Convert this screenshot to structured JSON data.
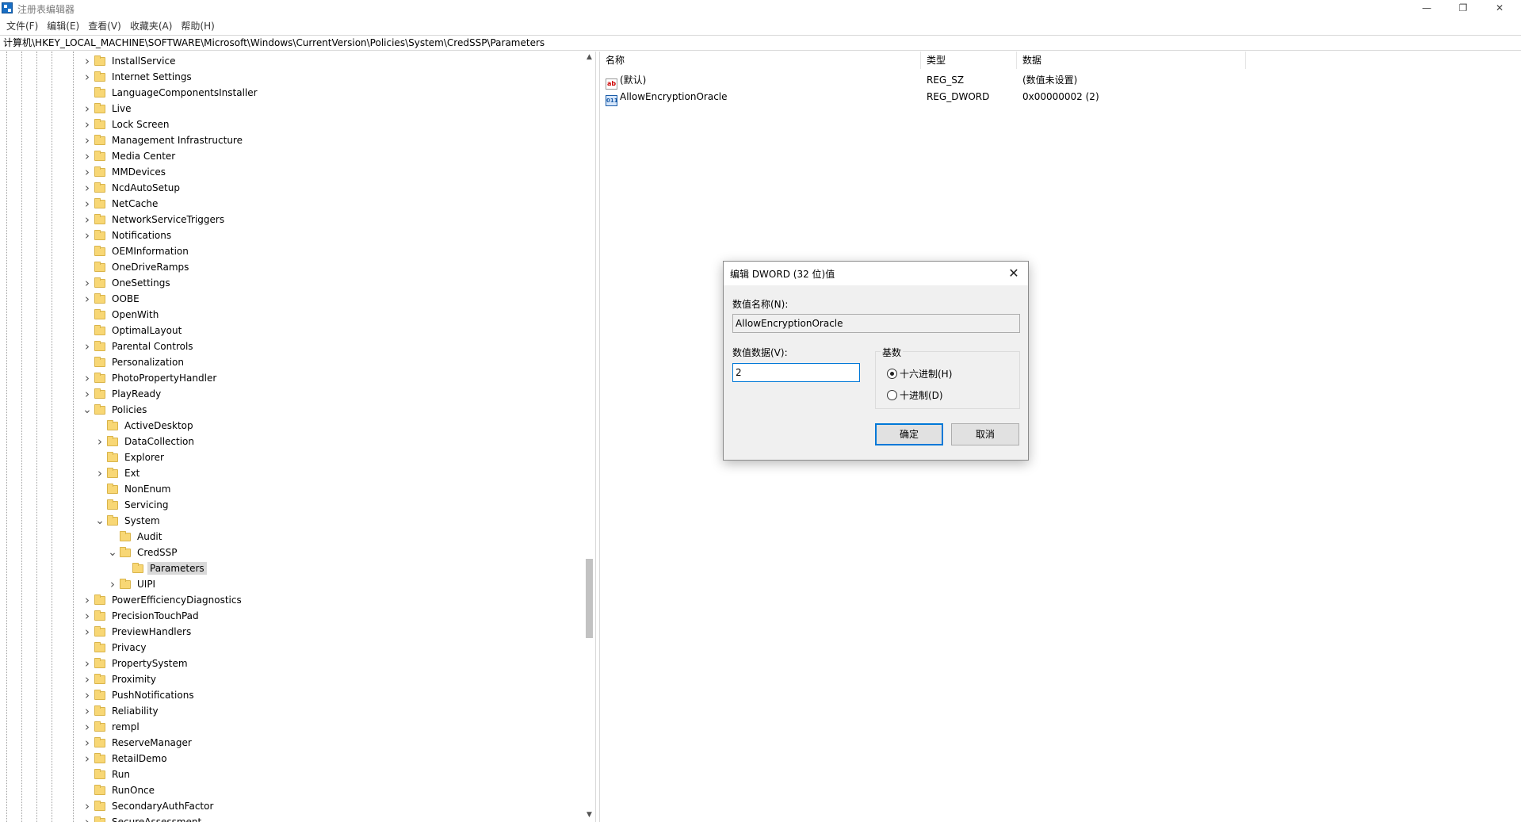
{
  "window": {
    "title": "注册表编辑器",
    "minimize_glyph": "—",
    "restore_glyph": "❐",
    "close_glyph": "✕"
  },
  "menu": [
    "文件(F)",
    "编辑(E)",
    "查看(V)",
    "收藏夹(A)",
    "帮助(H)"
  ],
  "address": "计算机\\HKEY_LOCAL_MACHINE\\SOFTWARE\\Microsoft\\Windows\\CurrentVersion\\Policies\\System\\CredSSP\\Parameters",
  "tree": [
    {
      "label": "InstallService",
      "level": 0,
      "expander": "collapsed"
    },
    {
      "label": "Internet Settings",
      "level": 0,
      "expander": "collapsed"
    },
    {
      "label": "LanguageComponentsInstaller",
      "level": 0,
      "expander": "none"
    },
    {
      "label": "Live",
      "level": 0,
      "expander": "collapsed"
    },
    {
      "label": "Lock Screen",
      "level": 0,
      "expander": "collapsed"
    },
    {
      "label": "Management Infrastructure",
      "level": 0,
      "expander": "collapsed"
    },
    {
      "label": "Media Center",
      "level": 0,
      "expander": "collapsed"
    },
    {
      "label": "MMDevices",
      "level": 0,
      "expander": "collapsed"
    },
    {
      "label": "NcdAutoSetup",
      "level": 0,
      "expander": "collapsed"
    },
    {
      "label": "NetCache",
      "level": 0,
      "expander": "collapsed"
    },
    {
      "label": "NetworkServiceTriggers",
      "level": 0,
      "expander": "collapsed"
    },
    {
      "label": "Notifications",
      "level": 0,
      "expander": "collapsed"
    },
    {
      "label": "OEMInformation",
      "level": 0,
      "expander": "none"
    },
    {
      "label": "OneDriveRamps",
      "level": 0,
      "expander": "none"
    },
    {
      "label": "OneSettings",
      "level": 0,
      "expander": "collapsed"
    },
    {
      "label": "OOBE",
      "level": 0,
      "expander": "collapsed"
    },
    {
      "label": "OpenWith",
      "level": 0,
      "expander": "none"
    },
    {
      "label": "OptimalLayout",
      "level": 0,
      "expander": "none"
    },
    {
      "label": "Parental Controls",
      "level": 0,
      "expander": "collapsed"
    },
    {
      "label": "Personalization",
      "level": 0,
      "expander": "none"
    },
    {
      "label": "PhotoPropertyHandler",
      "level": 0,
      "expander": "collapsed"
    },
    {
      "label": "PlayReady",
      "level": 0,
      "expander": "collapsed"
    },
    {
      "label": "Policies",
      "level": 0,
      "expander": "expanded"
    },
    {
      "label": "ActiveDesktop",
      "level": 1,
      "expander": "none"
    },
    {
      "label": "DataCollection",
      "level": 1,
      "expander": "collapsed"
    },
    {
      "label": "Explorer",
      "level": 1,
      "expander": "none"
    },
    {
      "label": "Ext",
      "level": 1,
      "expander": "collapsed"
    },
    {
      "label": "NonEnum",
      "level": 1,
      "expander": "none"
    },
    {
      "label": "Servicing",
      "level": 1,
      "expander": "none"
    },
    {
      "label": "System",
      "level": 1,
      "expander": "expanded"
    },
    {
      "label": "Audit",
      "level": 2,
      "expander": "none"
    },
    {
      "label": "CredSSP",
      "level": 2,
      "expander": "expanded"
    },
    {
      "label": "Parameters",
      "level": 3,
      "expander": "none",
      "selected": true
    },
    {
      "label": "UIPI",
      "level": 2,
      "expander": "collapsed"
    },
    {
      "label": "PowerEfficiencyDiagnostics",
      "level": 0,
      "expander": "collapsed"
    },
    {
      "label": "PrecisionTouchPad",
      "level": 0,
      "expander": "collapsed"
    },
    {
      "label": "PreviewHandlers",
      "level": 0,
      "expander": "collapsed"
    },
    {
      "label": "Privacy",
      "level": 0,
      "expander": "none"
    },
    {
      "label": "PropertySystem",
      "level": 0,
      "expander": "collapsed"
    },
    {
      "label": "Proximity",
      "level": 0,
      "expander": "collapsed"
    },
    {
      "label": "PushNotifications",
      "level": 0,
      "expander": "collapsed"
    },
    {
      "label": "Reliability",
      "level": 0,
      "expander": "collapsed"
    },
    {
      "label": "rempl",
      "level": 0,
      "expander": "collapsed"
    },
    {
      "label": "ReserveManager",
      "level": 0,
      "expander": "collapsed"
    },
    {
      "label": "RetailDemo",
      "level": 0,
      "expander": "collapsed"
    },
    {
      "label": "Run",
      "level": 0,
      "expander": "none"
    },
    {
      "label": "RunOnce",
      "level": 0,
      "expander": "none"
    },
    {
      "label": "SecondaryAuthFactor",
      "level": 0,
      "expander": "collapsed"
    },
    {
      "label": "SecureAssessment",
      "level": 0,
      "expander": "collapsed"
    }
  ],
  "list": {
    "headers": [
      "名称",
      "类型",
      "数据"
    ],
    "rows": [
      {
        "icon": "string-value-icon",
        "name": "(默认)",
        "type": "REG_SZ",
        "data": "(数值未设置)"
      },
      {
        "icon": "binary-value-icon",
        "name": "AllowEncryptionOracle",
        "type": "REG_DWORD",
        "data": "0x00000002 (2)"
      }
    ]
  },
  "dialog": {
    "title": "编辑 DWORD (32 位)值",
    "name_label": "数值名称(N):",
    "name_value": "AllowEncryptionOracle",
    "data_label": "数值数据(V):",
    "data_value": "2",
    "base_label": "基数",
    "hex_label": "十六进制(H)",
    "dec_label": "十进制(D)",
    "base_selected": "hex",
    "ok_label": "确定",
    "cancel_label": "取消",
    "close_glyph": "✕"
  }
}
